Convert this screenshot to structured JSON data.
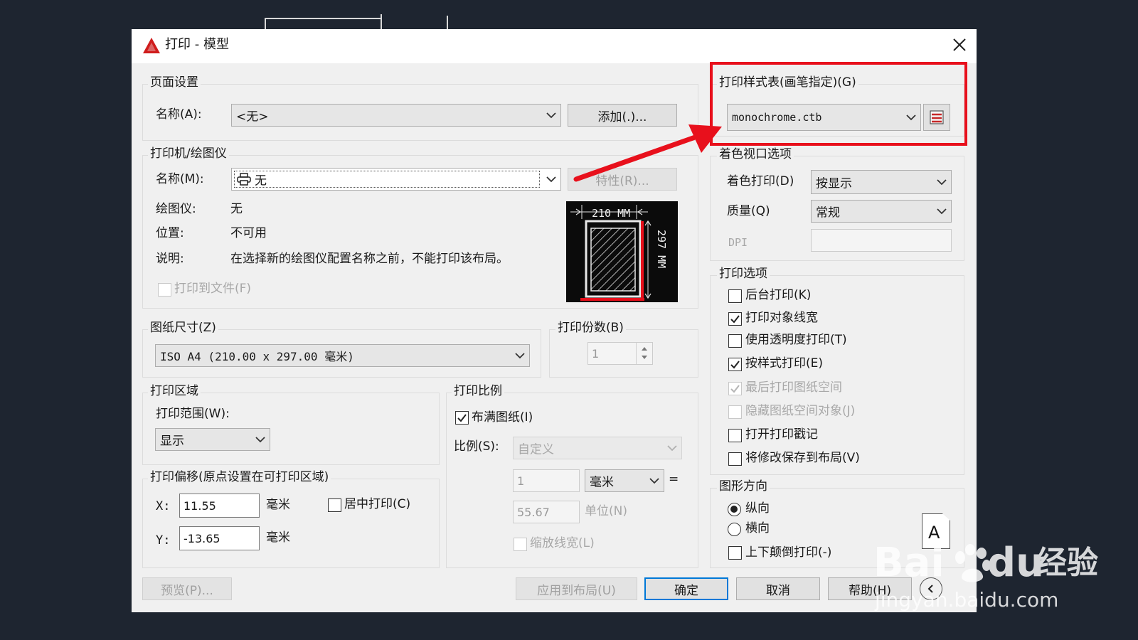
{
  "dialog": {
    "title": "打印 - 模型",
    "icon": "autocad-logo-icon"
  },
  "page_setup": {
    "legend": "页面设置",
    "name_label": "名称(A):",
    "name_value": "<无>",
    "add_button": "添加(.)..."
  },
  "printer": {
    "legend": "打印机/绘图仪",
    "name_label": "名称(M):",
    "name_value": "无",
    "properties_button": "特性(R)...",
    "plotter_label": "绘图仪:",
    "plotter_value": "无",
    "location_label": "位置:",
    "location_value": "不可用",
    "description_label": "说明:",
    "description_value": "在选择新的绘图仪配置名称之前，不能打印该布局。",
    "print_to_file": "打印到文件(F)",
    "preview_width": "210 MM",
    "preview_height": "297 MM"
  },
  "paper_size": {
    "legend": "图纸尺寸(Z)",
    "value": "ISO A4 (210.00 x 297.00 毫米)"
  },
  "copies": {
    "legend": "打印份数(B)",
    "value": "1"
  },
  "plot_area": {
    "legend": "打印区域",
    "range_label": "打印范围(W):",
    "range_value": "显示"
  },
  "plot_offset": {
    "legend": "打印偏移(原点设置在可打印区域)",
    "x_label": "X:",
    "x_value": "11.55",
    "x_unit": "毫米",
    "y_label": "Y:",
    "y_value": "-13.65",
    "y_unit": "毫米",
    "center_label": "居中打印(C)",
    "center_checked": false
  },
  "plot_scale": {
    "legend": "打印比例",
    "fit_label": "布满图纸(I)",
    "fit_checked": true,
    "scale_label": "比例(S):",
    "scale_value": "自定义",
    "value1": "1",
    "unit_value": "毫米",
    "equals": "=",
    "value2": "55.67",
    "unit_label": "单位(N)",
    "lineweight_label": "缩放线宽(L)"
  },
  "style_table": {
    "legend": "打印样式表(画笔指定)(G)",
    "value": "monochrome.ctb"
  },
  "shaded": {
    "legend": "着色视口选项",
    "shade_label": "着色打印(D)",
    "shade_value": "按显示",
    "quality_label": "质量(Q)",
    "quality_value": "常规",
    "dpi_label": "DPI"
  },
  "options": {
    "legend": "打印选项",
    "items": [
      {
        "label": "后台打印(K)",
        "checked": false,
        "disabled": false
      },
      {
        "label": "打印对象线宽",
        "checked": true,
        "disabled": false
      },
      {
        "label": "使用透明度打印(T)",
        "checked": false,
        "disabled": false
      },
      {
        "label": "按样式打印(E)",
        "checked": true,
        "disabled": false
      },
      {
        "label": "最后打印图纸空间",
        "checked": true,
        "disabled": true
      },
      {
        "label": "隐藏图纸空间对象(J)",
        "checked": false,
        "disabled": true
      },
      {
        "label": "打开打印戳记",
        "checked": false,
        "disabled": false
      },
      {
        "label": "将修改保存到布局(V)",
        "checked": false,
        "disabled": false
      }
    ]
  },
  "orientation": {
    "legend": "图形方向",
    "portrait": "纵向",
    "landscape": "横向",
    "upside_down": "上下颠倒打印(-)",
    "selected": "portrait",
    "icon_letter": "A"
  },
  "footer": {
    "preview": "预览(P)...",
    "apply": "应用到布局(U)",
    "ok": "确定",
    "cancel": "取消",
    "help": "帮助(H)"
  },
  "watermark": {
    "brand": "Bai",
    "brand2": "du",
    "cn": "经验",
    "url": "jingyan.baidu.com"
  },
  "colors": {
    "highlight": "#e8101c",
    "accent": "#0078d7",
    "background": "#1e2530"
  }
}
